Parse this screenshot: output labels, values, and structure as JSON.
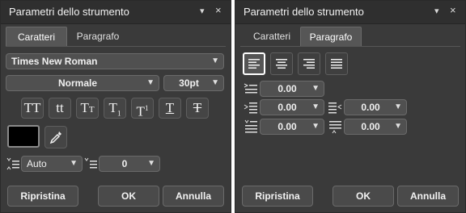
{
  "left_panel": {
    "title": "Parametri dello strumento",
    "minimize_glyph": "▾",
    "close_glyph": "×",
    "tabs": [
      {
        "label": "Caratteri",
        "active": true
      },
      {
        "label": "Paragrafo",
        "active": false
      }
    ],
    "font_family": "Times New Roman",
    "font_style": "Normale",
    "font_size": "30pt",
    "style_buttons": [
      {
        "name": "caps-all",
        "main": "TT",
        "small": ""
      },
      {
        "name": "lowercase",
        "main": "tt",
        "small": ""
      },
      {
        "name": "small-caps",
        "main": "T",
        "small": "T"
      },
      {
        "name": "subscript",
        "main": "T",
        "small": "1"
      },
      {
        "name": "superscript",
        "main": "T",
        "small": "1"
      },
      {
        "name": "underline",
        "main": "T",
        "small": ""
      },
      {
        "name": "strikethrough",
        "main": "T",
        "small": ""
      }
    ],
    "text_color": "#000000",
    "line_spacing": "Auto",
    "tracking": "0",
    "buttons": {
      "reset": "Ripristina",
      "ok": "OK",
      "cancel": "Annulla"
    }
  },
  "right_panel": {
    "title": "Parametri dello strumento",
    "minimize_glyph": "▾",
    "close_glyph": "×",
    "tabs": [
      {
        "label": "Caratteri",
        "active": false
      },
      {
        "label": "Paragrafo",
        "active": true
      }
    ],
    "alignments": [
      {
        "name": "left",
        "active": true
      },
      {
        "name": "center",
        "active": false
      },
      {
        "name": "right",
        "active": false
      },
      {
        "name": "justify",
        "active": false
      }
    ],
    "first_line_indent": "0.00",
    "left_indent": "0.00",
    "right_indent": "0.00",
    "space_before": "0.00",
    "space_after": "0.00",
    "buttons": {
      "reset": "Ripristina",
      "ok": "OK",
      "cancel": "Annulla"
    }
  },
  "colors": {
    "panel_bg": "#3a3a3a",
    "titlebar_bg": "#2f2f2f",
    "control_bg": "#505050",
    "text": "#f0f0f0"
  }
}
